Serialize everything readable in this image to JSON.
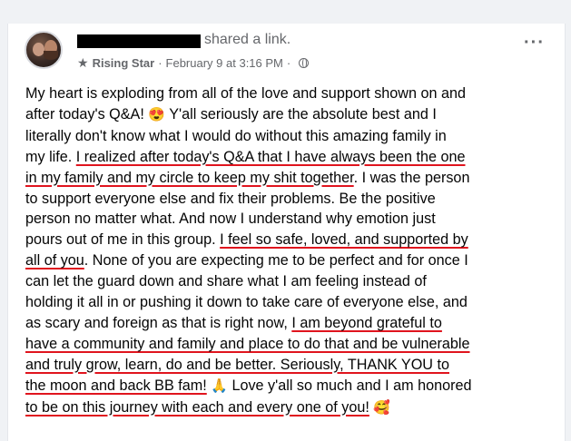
{
  "post": {
    "shared_text": "shared a link.",
    "badge": "Rising Star",
    "separator": "·",
    "timestamp": "February 9 at 3:16 PM",
    "icons": {
      "badge_icon": "star-icon",
      "privacy_icon": "globe-icon",
      "menu_icon": "more-options-icon"
    },
    "underline_color": "#e0141e",
    "body_lines": [
      {
        "a": "My heart is exploding from all of the love and support shown on and",
        "u": "",
        "b": ""
      },
      {
        "a": "after today's Q&A! ",
        "u": "",
        "b": " Y'all seriously are the absolute best and I",
        "emoji": "😍"
      },
      {
        "a": "literally don't know what I would do without this amazing family in",
        "u": "",
        "b": ""
      },
      {
        "a": "my life. ",
        "u": "I realized after today's Q&A that I have always been the one",
        "b": ""
      },
      {
        "a": "",
        "u": "in my family and my circle to keep my shit together",
        "b": ". I was the person"
      },
      {
        "a": "to support everyone else and fix their problems. Be the positive",
        "u": "",
        "b": ""
      },
      {
        "a": "person no matter what. And now I understand why emotion just",
        "u": "",
        "b": ""
      },
      {
        "a": "pours out of me in this group. ",
        "u": "I feel so safe, loved, and supported by",
        "b": ""
      },
      {
        "a": "",
        "u": "all of you",
        "b": ". None of you are expecting me to be perfect and for once I"
      },
      {
        "a": "can let the guard down and share what I am feeling instead of",
        "u": "",
        "b": ""
      },
      {
        "a": "holding it all in or pushing it down to take care of everyone else, and",
        "u": "",
        "b": ""
      },
      {
        "a": "as scary and foreign as that is right now, ",
        "u": "I am beyond grateful to",
        "b": ""
      },
      {
        "a": "",
        "u": "have a community and family and place to do that and be vulnerable",
        "b": ""
      },
      {
        "a": "",
        "u": "and truly grow, learn, do and be better. Seriously, THANK YOU to",
        "b": ""
      },
      {
        "a": "",
        "u": "the moon and back BB fam!",
        "b": " Love y'all so much and I am honored",
        "emoji": "🙏"
      },
      {
        "a": "",
        "u": "to be on this journey with each and every one of you!",
        "b": " ",
        "emoji": "🥰"
      }
    ]
  }
}
